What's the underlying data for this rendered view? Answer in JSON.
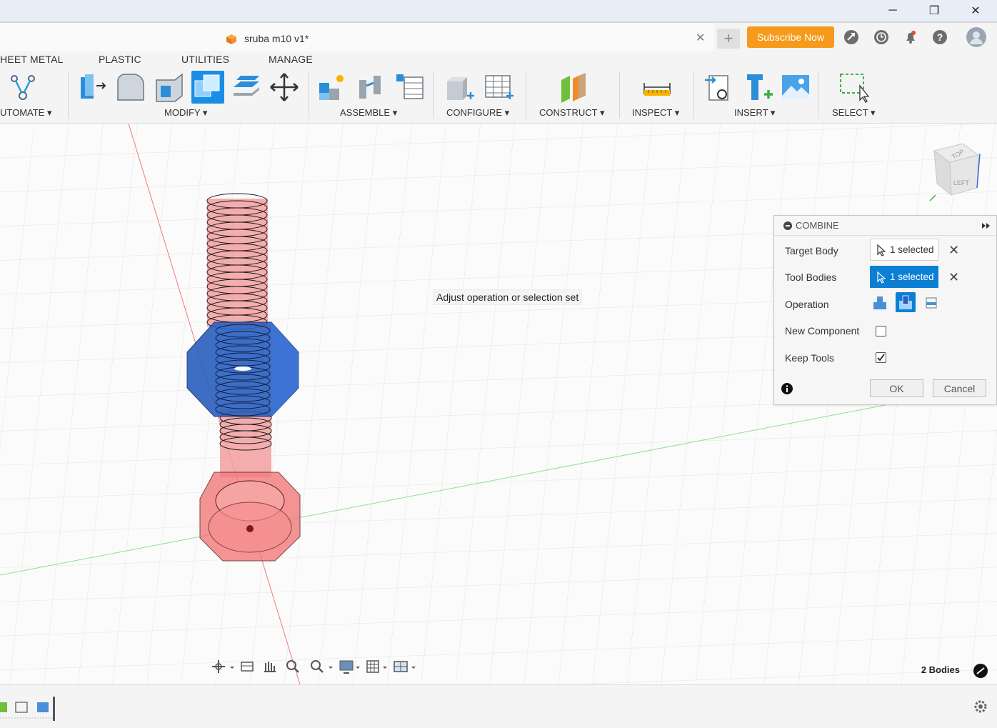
{
  "window": {
    "minimize": "─",
    "restore": "❐",
    "close": "✕"
  },
  "tabs": {
    "document_title": "sruba m10 v1*",
    "close": "✕",
    "new_tab": "+"
  },
  "header": {
    "subscribe_label": "Subscribe Now"
  },
  "ribbon": {
    "tabs": [
      "HEET METAL",
      "PLASTIC",
      "UTILITIES",
      "MANAGE"
    ],
    "groups": [
      "UTOMATE ▾",
      "MODIFY ▾",
      "ASSEMBLE ▾",
      "CONFIGURE ▾",
      "CONSTRUCT ▾",
      "INSPECT ▾",
      "INSERT ▾",
      "SELECT ▾"
    ]
  },
  "viewcube": {
    "top": "TOP",
    "left": "LEFT"
  },
  "viewport": {
    "tooltip": "Adjust operation or selection set",
    "bodies_count": "2 Bodies"
  },
  "combine": {
    "title": "COMBINE",
    "target_body_label": "Target Body",
    "target_body_value": "1 selected",
    "tool_bodies_label": "Tool Bodies",
    "tool_bodies_value": "1 selected",
    "operation_label": "Operation",
    "operation_selected": "cut",
    "new_component_label": "New Component",
    "new_component_checked": false,
    "keep_tools_label": "Keep Tools",
    "keep_tools_checked": true,
    "ok_label": "OK",
    "cancel_label": "Cancel"
  },
  "colors": {
    "accent": "#0b7fd4",
    "subscribe": "#f59a1b",
    "bolt": "#e64a4a",
    "nut": "#2a5fbf"
  }
}
